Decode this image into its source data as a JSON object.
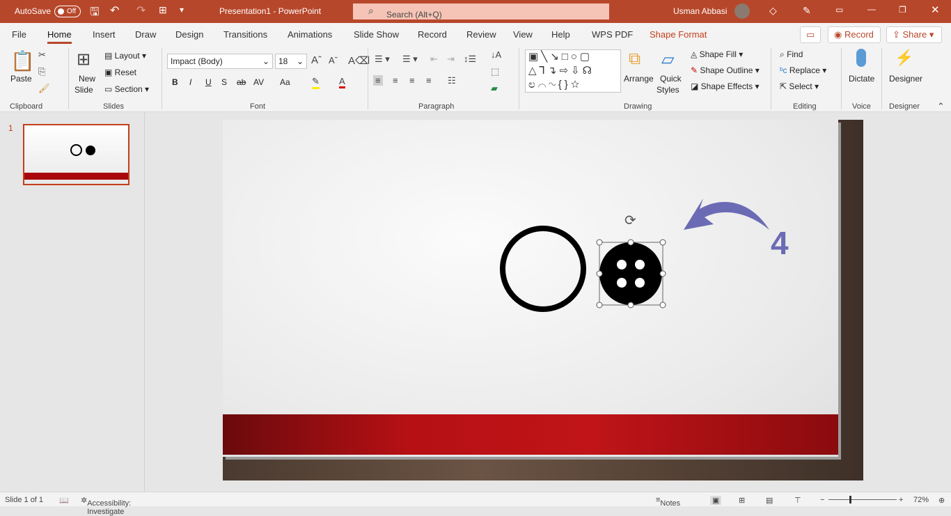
{
  "titlebar": {
    "autosave": "AutoSave",
    "autosave_state": "Off",
    "title": "Presentation1  -  PowerPoint",
    "search_placeholder": "Search (Alt+Q)",
    "user": "Usman Abbasi"
  },
  "tabs": [
    "File",
    "Home",
    "Insert",
    "Draw",
    "Design",
    "Transitions",
    "Animations",
    "Slide Show",
    "Record",
    "Review",
    "View",
    "Help",
    "WPS PDF",
    "Shape Format"
  ],
  "active_tab": "Home",
  "top_buttons": {
    "record": "Record",
    "share": "Share"
  },
  "ribbon": {
    "clipboard": {
      "label": "Clipboard",
      "paste": "Paste"
    },
    "slides": {
      "label": "Slides",
      "new_slide": "New",
      "new_slide2": "Slide",
      "layout": "Layout",
      "reset": "Reset",
      "section": "Section"
    },
    "font": {
      "label": "Font",
      "font_name": "Impact (Body)",
      "font_size": "18",
      "bold": "B",
      "italic": "I",
      "underline": "U",
      "shadow": "S",
      "strike": "ab",
      "spacing": "AV",
      "case": "Aa"
    },
    "paragraph": {
      "label": "Paragraph"
    },
    "drawing": {
      "label": "Drawing",
      "arrange": "Arrange",
      "quick_styles": "Quick",
      "quick_styles2": "Styles",
      "shape_fill": "Shape Fill",
      "shape_outline": "Shape Outline",
      "shape_effects": "Shape Effects"
    },
    "editing": {
      "label": "Editing",
      "find": "Find",
      "replace": "Replace",
      "select": "Select"
    },
    "voice": {
      "label": "Voice",
      "dictate": "Dictate"
    },
    "designer": {
      "label": "Designer",
      "designer": "Designer"
    }
  },
  "slide_panel": {
    "number": "1"
  },
  "slide": {
    "annotation": "4",
    "arrow_color": "#6b6bb5"
  },
  "status": {
    "slide": "Slide 1 of 1",
    "accessibility": "Accessibility: Investigate",
    "notes": "Notes",
    "zoom": "72%"
  },
  "colors": {
    "accent": "#b7472a",
    "band": "#b61014"
  }
}
